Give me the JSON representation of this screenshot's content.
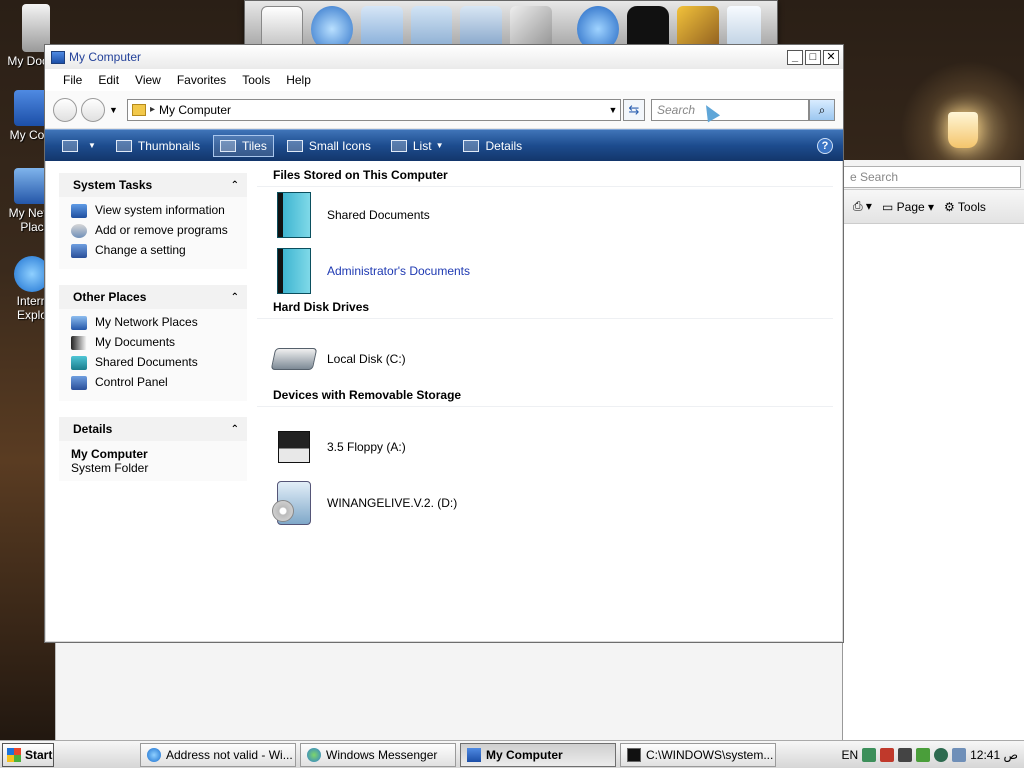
{
  "desktop": {
    "icons": [
      {
        "label": "My Docum",
        "prefix": "My"
      },
      {
        "label": "My Com"
      },
      {
        "label": "My Netw Plac"
      },
      {
        "label": "Intern Explo"
      }
    ]
  },
  "window": {
    "title": "My Computer",
    "controls": {
      "minimize": "_",
      "maximize": "□",
      "close": "✕"
    },
    "menu": [
      "File",
      "Edit",
      "View",
      "Favorites",
      "Tools",
      "Help"
    ],
    "address": {
      "value": "My Computer"
    },
    "search": {
      "placeholder": "Search"
    },
    "toolbar": {
      "views": [
        {
          "label": "Thumbnails",
          "active": false
        },
        {
          "label": "Tiles",
          "active": true
        },
        {
          "label": "Small Icons",
          "active": false
        },
        {
          "label": "List",
          "active": false
        },
        {
          "label": "Details",
          "active": false
        }
      ],
      "help": "?"
    },
    "sidebar": {
      "system_tasks": {
        "title": "System Tasks",
        "items": [
          "View system information",
          "Add or remove programs",
          "Change a setting"
        ]
      },
      "other_places": {
        "title": "Other Places",
        "items": [
          "My Network Places",
          "My Documents",
          "Shared Documents",
          "Control Panel"
        ]
      },
      "details": {
        "title": "Details",
        "name": "My Computer",
        "type": "System Folder"
      }
    },
    "groups": {
      "files": {
        "title": "Files Stored on This Computer",
        "items": [
          "Shared Documents",
          "Administrator's Documents"
        ]
      },
      "disks": {
        "title": "Hard Disk Drives",
        "items": [
          "Local Disk (C:)"
        ]
      },
      "removable": {
        "title": "Devices with Removable Storage",
        "items": [
          "3.5 Floppy (A:)",
          "WINANGELIVE.V.2. (D:)"
        ]
      }
    }
  },
  "background_window": {
    "search_text": "e Search",
    "page_label": "Page",
    "tools_label": "Tools"
  },
  "taskbar": {
    "start": "Start",
    "tasks": [
      {
        "label": "Address not valid - Wi...",
        "active": false
      },
      {
        "label": "Windows Messenger",
        "active": false
      },
      {
        "label": "My Computer",
        "active": true
      },
      {
        "label": "C:\\WINDOWS\\system...",
        "active": false
      }
    ],
    "lang": "EN",
    "clock": "12:41 ص"
  },
  "colors": {
    "toolbar_blue": "#1d4c8e",
    "link_blue": "#1e39b2",
    "title_blue": "#24429a"
  }
}
